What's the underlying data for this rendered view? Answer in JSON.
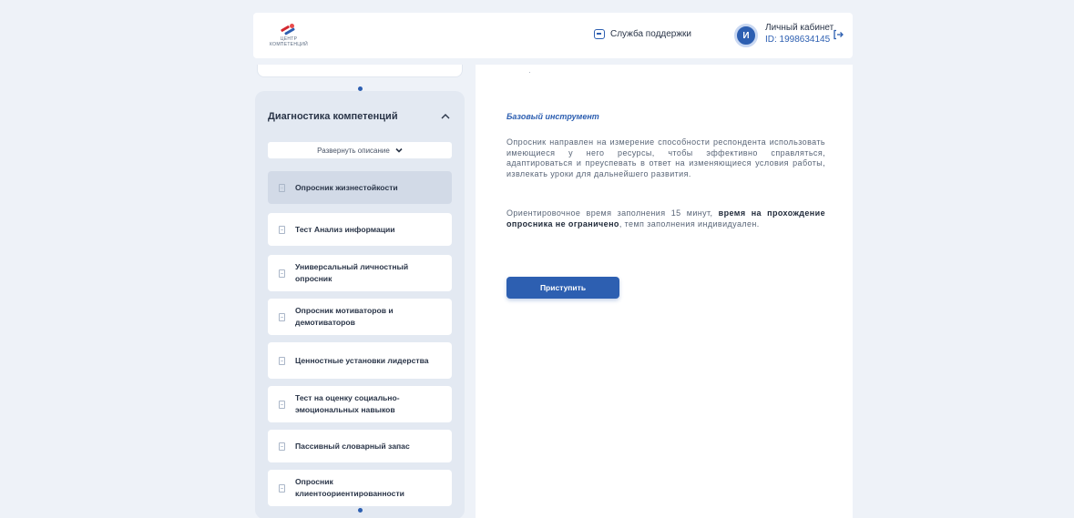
{
  "header": {
    "logo_text": "ЦЕНТР КОМПЕТЕНЦИЙ",
    "support_label": "Служба поддержки",
    "avatar_initial": "И",
    "account_title": "Личный кабинет",
    "account_id": "ID: 1998634145"
  },
  "sidebar": {
    "title": "Диагностика компетенций",
    "expand_label": "Развернуть описание",
    "items": [
      {
        "label": "Опросник жизнестойкости",
        "active": true
      },
      {
        "label": "Тест Анализ информации"
      },
      {
        "label": "Универсальный личностный опросник"
      },
      {
        "label": "Опросник мотиваторов и демотиваторов"
      },
      {
        "label": "Ценностные установки лидерства"
      },
      {
        "label": "Тест на оценку социально-эмоциональных навыков"
      },
      {
        "label": "Пассивный словарный запас"
      },
      {
        "label": "Опросник клиентоориентированности"
      }
    ]
  },
  "content": {
    "top_marker": "·",
    "tag": "Базовый инструмент",
    "description": "Опросник направлен на измерение способности респондента использовать имеющиеся у него ресурсы, чтобы эффективно справляться, адаптироваться и преуспевать в ответ на изменяющиеся условия работы, извлекать уроки для дальнейшего развития.",
    "time_prefix": "Ориентировочное время заполнения 15 минут, ",
    "time_bold": "время на прохождение опросника не ограничено",
    "time_suffix": ", темп заполнения индивидуален.",
    "start_label": "Приступить"
  },
  "colors": {
    "accent": "#2d5fb1",
    "background": "#eef2f8",
    "sidebar_bg": "#e3e9f2",
    "active_item": "#d2dae7"
  },
  "icons": {
    "support": "chat-icon",
    "logout": "logout-icon",
    "collapse": "chevron-up-icon",
    "expand": "chevron-down-icon",
    "item": "document-icon"
  }
}
